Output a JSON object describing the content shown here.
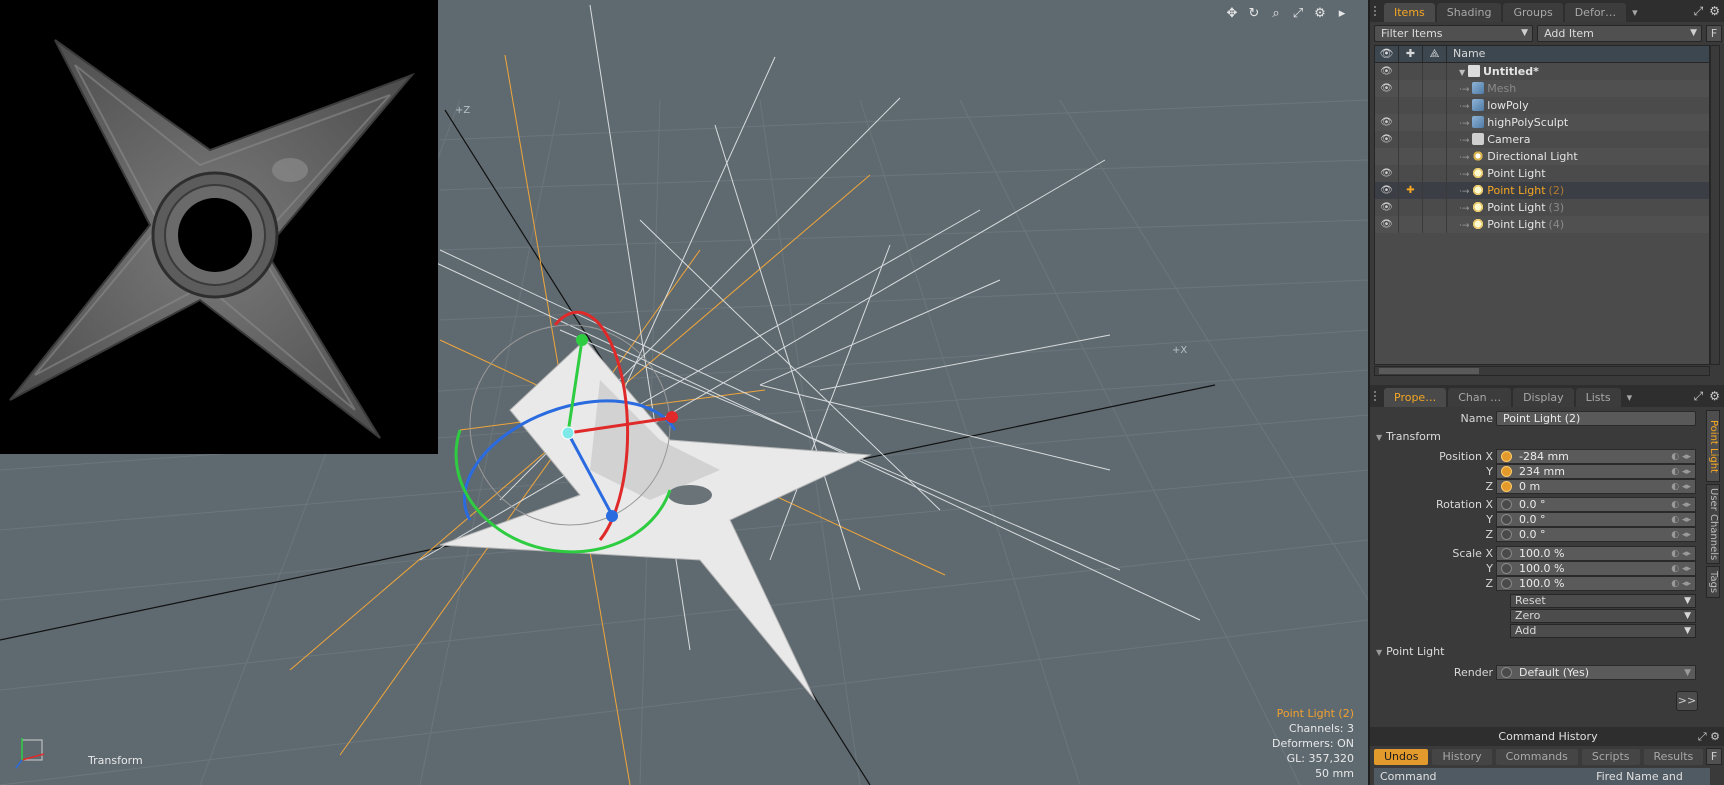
{
  "viewport": {
    "tools": [
      "move-icon",
      "rotate-icon",
      "zoom-icon",
      "maximize-icon",
      "gear-icon",
      "play-icon"
    ],
    "mode_label": "Transform",
    "axis_label_z": "+Z",
    "axis_label_x": "+X",
    "info": {
      "selected": "Point Light (2)",
      "channels": "Channels: 3",
      "deformers": "Deformers: ON",
      "gl": "GL: 357,320",
      "lens": "50 mm"
    }
  },
  "items_panel": {
    "tabs": [
      "Items",
      "Shading",
      "Groups",
      "Defor…"
    ],
    "active_tab": "Items",
    "filter_label": "Filter Items",
    "add_item_label": "Add Item",
    "f_button": "F",
    "header_name": "Name",
    "items": [
      {
        "name": "Untitled*",
        "suffix": "",
        "icon": "scene",
        "visible": true,
        "root": true
      },
      {
        "name": "Mesh",
        "suffix": "",
        "icon": "mesh",
        "visible": true,
        "muted": true
      },
      {
        "name": "lowPoly",
        "suffix": "",
        "icon": "mesh",
        "visible": false
      },
      {
        "name": "highPolySculpt",
        "suffix": "",
        "icon": "mesh",
        "visible": true
      },
      {
        "name": "Camera",
        "suffix": "",
        "icon": "camera",
        "visible": true
      },
      {
        "name": "Directional Light",
        "suffix": "",
        "icon": "dlight",
        "visible": false
      },
      {
        "name": "Point Light",
        "suffix": "",
        "icon": "light",
        "visible": true
      },
      {
        "name": "Point Light",
        "suffix": "(2)",
        "icon": "light",
        "visible": true,
        "selected": true
      },
      {
        "name": "Point Light",
        "suffix": "(3)",
        "icon": "light",
        "visible": true
      },
      {
        "name": "Point Light",
        "suffix": "(4)",
        "icon": "light",
        "visible": true
      }
    ]
  },
  "properties_panel": {
    "tabs": [
      "Prope…",
      "Chan …",
      "Display",
      "Lists"
    ],
    "active_tab": "Prope…",
    "name_label": "Name",
    "name_value": "Point Light (2)",
    "section_transform": "Transform",
    "position_label": "Position X",
    "rotation_label": "Rotation X",
    "scale_label": "Scale X",
    "y_label": "Y",
    "z_label": "Z",
    "position": [
      "-284 mm",
      "234 mm",
      "0 m"
    ],
    "rotation": [
      "0.0 °",
      "0.0 °",
      "0.0 °"
    ],
    "scale": [
      "100.0 %",
      "100.0 %",
      "100.0 %"
    ],
    "reset_label": "Reset",
    "zero_label": "Zero",
    "add_label": "Add",
    "section_light": "Point Light",
    "render_label": "Render",
    "render_value": "Default (Yes)",
    "more_label": ">>",
    "vertical_tabs": [
      "Point Light",
      "User Channels",
      "Tags"
    ]
  },
  "command_history": {
    "title": "Command History",
    "tabs": [
      "Undos",
      "History",
      "Commands",
      "Scripts",
      "Results"
    ],
    "active_tab": "Undos",
    "f_button": "F",
    "columns": [
      "Command",
      "Fired Name and Argu"
    ]
  },
  "colors": {
    "accent": "#f5a623",
    "viewport_bg": "#5f6a70",
    "panel_bg": "#3a3a3a"
  }
}
